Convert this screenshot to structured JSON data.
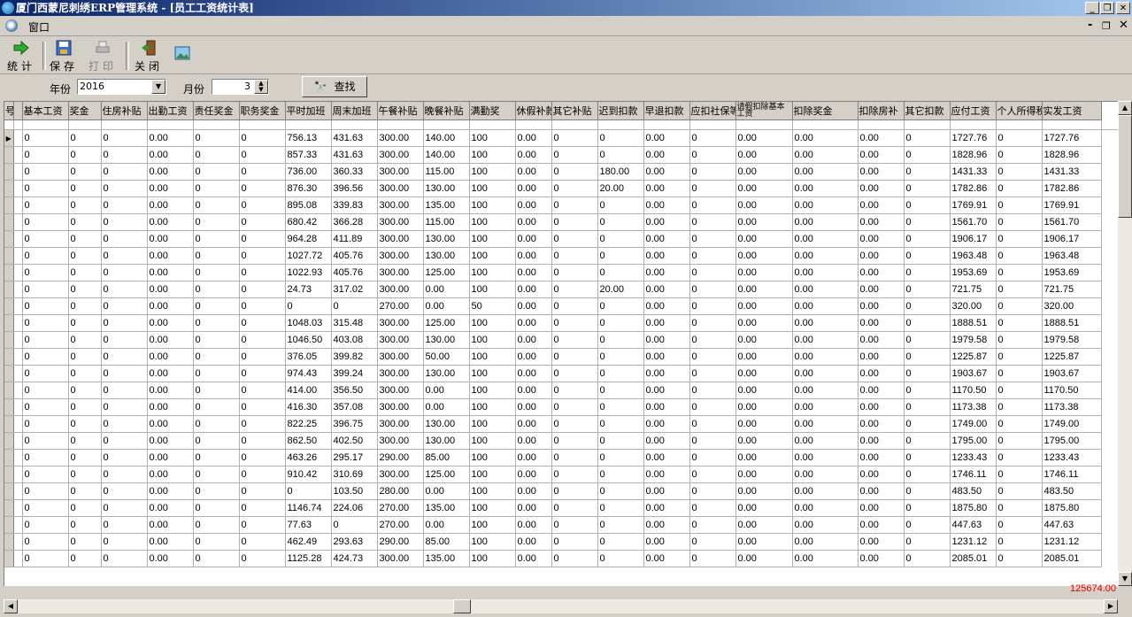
{
  "window": {
    "title": "厦门西蒙尼刺绣ERP管理系统 - [员工工资统计表]"
  },
  "menu": {
    "window_menu": "窗口"
  },
  "toolbar": {
    "stat": "统计",
    "save": "保存",
    "print": "打印",
    "close": "关闭"
  },
  "filter": {
    "year_label": "年份",
    "year_value": "2016",
    "month_label": "月份",
    "month_value": "3",
    "find_label": "查找"
  },
  "table": {
    "columns": [
      "基本工资",
      "奖金",
      "住房补贴",
      "出勤工资",
      "责任奖金",
      "职务奖金",
      "平时加班",
      "周末加班",
      "午餐补贴",
      "晚餐补贴",
      "满勤奖",
      "休假补款",
      "其它补贴",
      "迟到扣款",
      "早退扣款",
      "应扣社保等",
      "请假扣除基本工资",
      "扣除奖金",
      "扣除房补",
      "其它扣款",
      "应付工资",
      "个人所得税",
      "实发工资"
    ],
    "partial_first_col": "号",
    "rows": [
      [
        "0",
        "0",
        "0",
        "0.00",
        "0",
        "0",
        "756.13",
        "431.63",
        "300.00",
        "140.00",
        "100",
        "0.00",
        "0",
        "0",
        "0.00",
        "0",
        "0.00",
        "0.00",
        "0.00",
        "0",
        "1727.76",
        "0",
        "1727.76"
      ],
      [
        "0",
        "0",
        "0",
        "0.00",
        "0",
        "0",
        "857.33",
        "431.63",
        "300.00",
        "140.00",
        "100",
        "0.00",
        "0",
        "0",
        "0.00",
        "0",
        "0.00",
        "0.00",
        "0.00",
        "0",
        "1828.96",
        "0",
        "1828.96"
      ],
      [
        "0",
        "0",
        "0",
        "0.00",
        "0",
        "0",
        "736.00",
        "360.33",
        "300.00",
        "115.00",
        "100",
        "0.00",
        "0",
        "180.00",
        "0.00",
        "0",
        "0.00",
        "0.00",
        "0.00",
        "0",
        "1431.33",
        "0",
        "1431.33"
      ],
      [
        "0",
        "0",
        "0",
        "0.00",
        "0",
        "0",
        "876.30",
        "396.56",
        "300.00",
        "130.00",
        "100",
        "0.00",
        "0",
        "20.00",
        "0.00",
        "0",
        "0.00",
        "0.00",
        "0.00",
        "0",
        "1782.86",
        "0",
        "1782.86"
      ],
      [
        "0",
        "0",
        "0",
        "0.00",
        "0",
        "0",
        "895.08",
        "339.83",
        "300.00",
        "135.00",
        "100",
        "0.00",
        "0",
        "0",
        "0.00",
        "0",
        "0.00",
        "0.00",
        "0.00",
        "0",
        "1769.91",
        "0",
        "1769.91"
      ],
      [
        "0",
        "0",
        "0",
        "0.00",
        "0",
        "0",
        "680.42",
        "366.28",
        "300.00",
        "115.00",
        "100",
        "0.00",
        "0",
        "0",
        "0.00",
        "0",
        "0.00",
        "0.00",
        "0.00",
        "0",
        "1561.70",
        "0",
        "1561.70"
      ],
      [
        "0",
        "0",
        "0",
        "0.00",
        "0",
        "0",
        "964.28",
        "411.89",
        "300.00",
        "130.00",
        "100",
        "0.00",
        "0",
        "0",
        "0.00",
        "0",
        "0.00",
        "0.00",
        "0.00",
        "0",
        "1906.17",
        "0",
        "1906.17"
      ],
      [
        "0",
        "0",
        "0",
        "0.00",
        "0",
        "0",
        "1027.72",
        "405.76",
        "300.00",
        "130.00",
        "100",
        "0.00",
        "0",
        "0",
        "0.00",
        "0",
        "0.00",
        "0.00",
        "0.00",
        "0",
        "1963.48",
        "0",
        "1963.48"
      ],
      [
        "0",
        "0",
        "0",
        "0.00",
        "0",
        "0",
        "1022.93",
        "405.76",
        "300.00",
        "125.00",
        "100",
        "0.00",
        "0",
        "0",
        "0.00",
        "0",
        "0.00",
        "0.00",
        "0.00",
        "0",
        "1953.69",
        "0",
        "1953.69"
      ],
      [
        "0",
        "0",
        "0",
        "0.00",
        "0",
        "0",
        "24.73",
        "317.02",
        "300.00",
        "0.00",
        "100",
        "0.00",
        "0",
        "20.00",
        "0.00",
        "0",
        "0.00",
        "0.00",
        "0.00",
        "0",
        "721.75",
        "0",
        "721.75"
      ],
      [
        "0",
        "0",
        "0",
        "0.00",
        "0",
        "0",
        "0",
        "0",
        "270.00",
        "0.00",
        "50",
        "0.00",
        "0",
        "0",
        "0.00",
        "0",
        "0.00",
        "0.00",
        "0.00",
        "0",
        "320.00",
        "0",
        "320.00"
      ],
      [
        "0",
        "0",
        "0",
        "0.00",
        "0",
        "0",
        "1048.03",
        "315.48",
        "300.00",
        "125.00",
        "100",
        "0.00",
        "0",
        "0",
        "0.00",
        "0",
        "0.00",
        "0.00",
        "0.00",
        "0",
        "1888.51",
        "0",
        "1888.51"
      ],
      [
        "0",
        "0",
        "0",
        "0.00",
        "0",
        "0",
        "1046.50",
        "403.08",
        "300.00",
        "130.00",
        "100",
        "0.00",
        "0",
        "0",
        "0.00",
        "0",
        "0.00",
        "0.00",
        "0.00",
        "0",
        "1979.58",
        "0",
        "1979.58"
      ],
      [
        "0",
        "0",
        "0",
        "0.00",
        "0",
        "0",
        "376.05",
        "399.82",
        "300.00",
        "50.00",
        "100",
        "0.00",
        "0",
        "0",
        "0.00",
        "0",
        "0.00",
        "0.00",
        "0.00",
        "0",
        "1225.87",
        "0",
        "1225.87"
      ],
      [
        "0",
        "0",
        "0",
        "0.00",
        "0",
        "0",
        "974.43",
        "399.24",
        "300.00",
        "130.00",
        "100",
        "0.00",
        "0",
        "0",
        "0.00",
        "0",
        "0.00",
        "0.00",
        "0.00",
        "0",
        "1903.67",
        "0",
        "1903.67"
      ],
      [
        "0",
        "0",
        "0",
        "0.00",
        "0",
        "0",
        "414.00",
        "356.50",
        "300.00",
        "0.00",
        "100",
        "0.00",
        "0",
        "0",
        "0.00",
        "0",
        "0.00",
        "0.00",
        "0.00",
        "0",
        "1170.50",
        "0",
        "1170.50"
      ],
      [
        "0",
        "0",
        "0",
        "0.00",
        "0",
        "0",
        "416.30",
        "357.08",
        "300.00",
        "0.00",
        "100",
        "0.00",
        "0",
        "0",
        "0.00",
        "0",
        "0.00",
        "0.00",
        "0.00",
        "0",
        "1173.38",
        "0",
        "1173.38"
      ],
      [
        "0",
        "0",
        "0",
        "0.00",
        "0",
        "0",
        "822.25",
        "396.75",
        "300.00",
        "130.00",
        "100",
        "0.00",
        "0",
        "0",
        "0.00",
        "0",
        "0.00",
        "0.00",
        "0.00",
        "0",
        "1749.00",
        "0",
        "1749.00"
      ],
      [
        "0",
        "0",
        "0",
        "0.00",
        "0",
        "0",
        "862.50",
        "402.50",
        "300.00",
        "130.00",
        "100",
        "0.00",
        "0",
        "0",
        "0.00",
        "0",
        "0.00",
        "0.00",
        "0.00",
        "0",
        "1795.00",
        "0",
        "1795.00"
      ],
      [
        "0",
        "0",
        "0",
        "0.00",
        "0",
        "0",
        "463.26",
        "295.17",
        "290.00",
        "85.00",
        "100",
        "0.00",
        "0",
        "0",
        "0.00",
        "0",
        "0.00",
        "0.00",
        "0.00",
        "0",
        "1233.43",
        "0",
        "1233.43"
      ],
      [
        "0",
        "0",
        "0",
        "0.00",
        "0",
        "0",
        "910.42",
        "310.69",
        "300.00",
        "125.00",
        "100",
        "0.00",
        "0",
        "0",
        "0.00",
        "0",
        "0.00",
        "0.00",
        "0.00",
        "0",
        "1746.11",
        "0",
        "1746.11"
      ],
      [
        "0",
        "0",
        "0",
        "0.00",
        "0",
        "0",
        "0",
        "103.50",
        "280.00",
        "0.00",
        "100",
        "0.00",
        "0",
        "0",
        "0.00",
        "0",
        "0.00",
        "0.00",
        "0.00",
        "0",
        "483.50",
        "0",
        "483.50"
      ],
      [
        "0",
        "0",
        "0",
        "0.00",
        "0",
        "0",
        "1146.74",
        "224.06",
        "270.00",
        "135.00",
        "100",
        "0.00",
        "0",
        "0",
        "0.00",
        "0",
        "0.00",
        "0.00",
        "0.00",
        "0",
        "1875.80",
        "0",
        "1875.80"
      ],
      [
        "0",
        "0",
        "0",
        "0.00",
        "0",
        "0",
        "77.63",
        "0",
        "270.00",
        "0.00",
        "100",
        "0.00",
        "0",
        "0",
        "0.00",
        "0",
        "0.00",
        "0.00",
        "0.00",
        "0",
        "447.63",
        "0",
        "447.63"
      ],
      [
        "0",
        "0",
        "0",
        "0.00",
        "0",
        "0",
        "462.49",
        "293.63",
        "290.00",
        "85.00",
        "100",
        "0.00",
        "0",
        "0",
        "0.00",
        "0",
        "0.00",
        "0.00",
        "0.00",
        "0",
        "1231.12",
        "0",
        "1231.12"
      ],
      [
        "0",
        "0",
        "0",
        "0.00",
        "0",
        "0",
        "1125.28",
        "424.73",
        "300.00",
        "135.00",
        "100",
        "0.00",
        "0",
        "0",
        "0.00",
        "0",
        "0.00",
        "0.00",
        "0.00",
        "0",
        "2085.01",
        "0",
        "2085.01"
      ]
    ],
    "total_net": "125674.00"
  },
  "colors": {
    "title_start": "#0a246a",
    "title_end": "#a6caf0",
    "total": "#e00000"
  }
}
